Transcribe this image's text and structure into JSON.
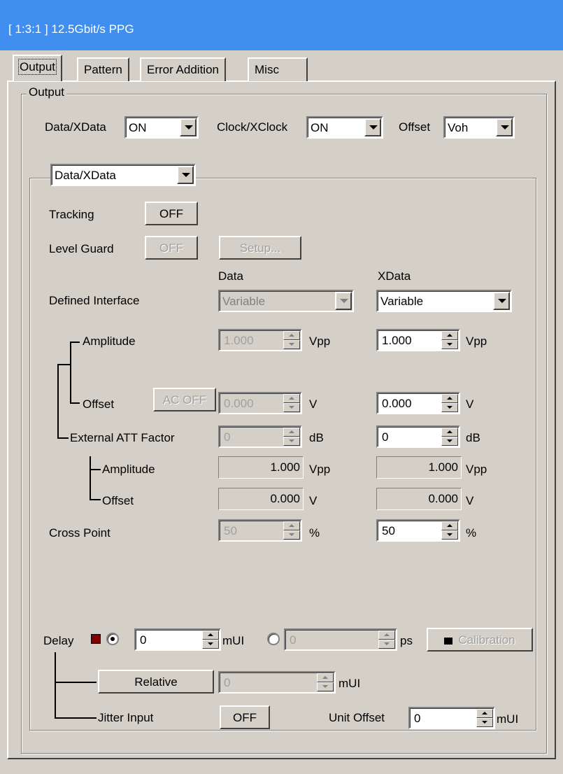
{
  "window": {
    "title": "[ 1:3:1 ] 12.5Gbit/s PPG"
  },
  "tabs": [
    {
      "label": "Output",
      "active": true
    },
    {
      "label": "Pattern",
      "active": false
    },
    {
      "label": "Error Addition",
      "active": false
    },
    {
      "label": "Misc",
      "active": false
    }
  ],
  "output_group": {
    "legend": "Output",
    "data_xdata_label": "Data/XData",
    "data_xdata_value": "ON",
    "clock_label": "Clock/XClock",
    "clock_value": "ON",
    "offset_label": "Offset",
    "offset_value": "Voh"
  },
  "channel_select": {
    "value": "Data/XData"
  },
  "tracking": {
    "label": "Tracking",
    "button": "OFF"
  },
  "level_guard": {
    "label": "Level Guard",
    "button": "OFF",
    "setup": "Setup..."
  },
  "columns": {
    "data": "Data",
    "xdata": "XData"
  },
  "defined_interface": {
    "label": "Defined Interface",
    "data_value": "Variable",
    "xdata_value": "Variable"
  },
  "amplitude": {
    "label": "Amplitude",
    "data_value": "1.000",
    "xdata_value": "1.000",
    "unit": "Vpp"
  },
  "offset": {
    "label": "Offset",
    "ac_button": "AC OFF",
    "data_value": "0.000",
    "xdata_value": "0.000",
    "unit": "V"
  },
  "ext_att": {
    "label": "External ATT Factor",
    "data_value": "0",
    "xdata_value": "0",
    "unit": "dB"
  },
  "ext_amplitude": {
    "label": "Amplitude",
    "data_value": "1.000",
    "xdata_value": "1.000",
    "unit": "Vpp"
  },
  "ext_offset": {
    "label": "Offset",
    "data_value": "0.000",
    "xdata_value": "0.000",
    "unit": "V"
  },
  "cross_point": {
    "label": "Cross Point",
    "data_value": "50",
    "xdata_value": "50",
    "unit": "%"
  },
  "delay": {
    "label": "Delay",
    "mui_value": "0",
    "mui_unit": "mUI",
    "ps_value": "0",
    "ps_unit": "ps",
    "calibration": "Calibration",
    "relative_button": "Relative",
    "relative_value": "0",
    "relative_unit": "mUI",
    "jitter_label": "Jitter Input",
    "jitter_button": "OFF",
    "unit_offset_label": "Unit Offset",
    "unit_offset_value": "0",
    "unit_offset_unit": "mUI"
  },
  "colors": {
    "title_bar": "#3f8ef0",
    "face": "#d4d0c8",
    "delay_led": "#800000"
  }
}
